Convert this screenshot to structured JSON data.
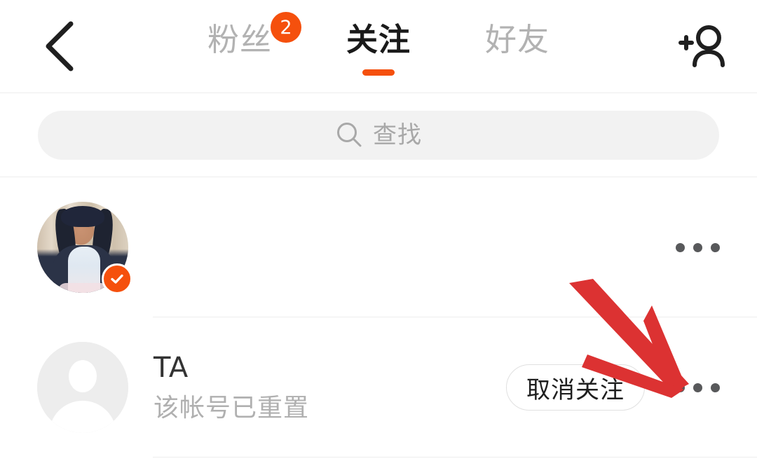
{
  "header": {
    "back_icon": "chevron-left-icon",
    "add_user_icon": "add-user-icon",
    "tabs": [
      {
        "label": "粉丝",
        "active": false,
        "badge": "2"
      },
      {
        "label": "关注",
        "active": true,
        "badge": ""
      },
      {
        "label": "好友",
        "active": false,
        "badge": ""
      }
    ]
  },
  "search": {
    "icon": "search-icon",
    "placeholder": "查找",
    "value": ""
  },
  "list": {
    "rows": [
      {
        "avatar_type": "photo",
        "verified": true,
        "verified_icon": "check-badge-icon",
        "name": "",
        "subtitle": "",
        "unfollow_label": "",
        "has_unfollow": false,
        "more_icon": "more-horizontal-icon"
      },
      {
        "avatar_type": "default",
        "verified": false,
        "verified_icon": "",
        "name": "TA",
        "subtitle": "该帐号已重置",
        "unfollow_label": "取消关注",
        "has_unfollow": true,
        "more_icon": "more-horizontal-icon"
      }
    ]
  },
  "annotation": {
    "type": "arrow",
    "color": "#DC3232",
    "points_to": "more-horizontal-icon-row-2"
  },
  "colors": {
    "accent": "#F5500D",
    "badge": "#F5500D",
    "active_tab_text": "#1A1A1A",
    "inactive_tab_text": "#B2B2B2",
    "divider": "#EDEDED",
    "search_bg": "#F2F2F2",
    "placeholder_text": "#A8A8A8",
    "name_text": "#333333",
    "subtitle_text": "#B0B0B0",
    "annotation_red": "#DC3232"
  }
}
